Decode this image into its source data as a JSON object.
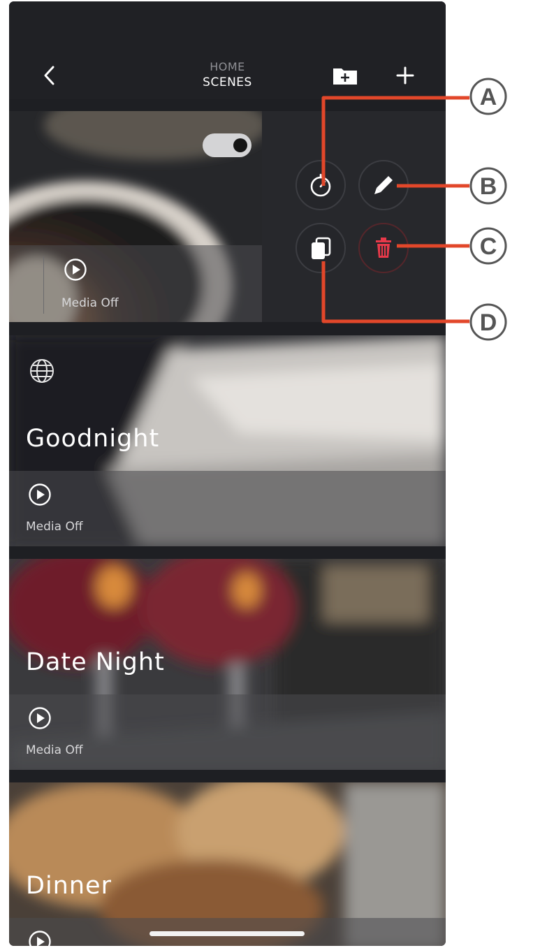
{
  "header": {
    "title_line1": "HOME",
    "title_line2": "SCENES"
  },
  "scenes": [
    {
      "name": "",
      "media_label": "Media Off",
      "toggle_on": true
    },
    {
      "name": "Goodnight",
      "media_label": "Media Off"
    },
    {
      "name": "Date Night",
      "media_label": "Media Off"
    },
    {
      "name": "Dinner",
      "media_label": ""
    }
  ],
  "callouts": [
    "A",
    "B",
    "C",
    "D"
  ],
  "icons": {
    "back": "chevron-left-icon",
    "folder_add": "folder-add-icon",
    "add": "plus-icon",
    "timer": "stopwatch-icon",
    "edit": "pencil-icon",
    "duplicate": "copy-icon",
    "delete": "trash-icon",
    "web": "globe-icon",
    "play": "play-circle-icon"
  },
  "colors": {
    "callout": "#e2472a",
    "delete": "#e8394a",
    "background": "#1e1f23"
  }
}
